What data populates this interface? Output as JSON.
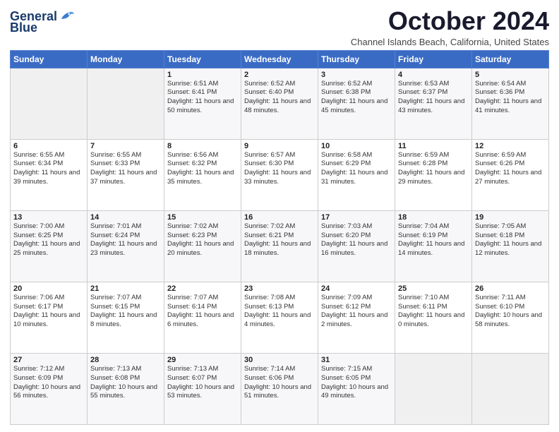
{
  "logo": {
    "line1": "General",
    "line2": "Blue"
  },
  "title": "October 2024",
  "location": "Channel Islands Beach, California, United States",
  "days_of_week": [
    "Sunday",
    "Monday",
    "Tuesday",
    "Wednesday",
    "Thursday",
    "Friday",
    "Saturday"
  ],
  "weeks": [
    [
      {
        "num": "",
        "info": ""
      },
      {
        "num": "",
        "info": ""
      },
      {
        "num": "1",
        "info": "Sunrise: 6:51 AM\nSunset: 6:41 PM\nDaylight: 11 hours and 50 minutes."
      },
      {
        "num": "2",
        "info": "Sunrise: 6:52 AM\nSunset: 6:40 PM\nDaylight: 11 hours and 48 minutes."
      },
      {
        "num": "3",
        "info": "Sunrise: 6:52 AM\nSunset: 6:38 PM\nDaylight: 11 hours and 45 minutes."
      },
      {
        "num": "4",
        "info": "Sunrise: 6:53 AM\nSunset: 6:37 PM\nDaylight: 11 hours and 43 minutes."
      },
      {
        "num": "5",
        "info": "Sunrise: 6:54 AM\nSunset: 6:36 PM\nDaylight: 11 hours and 41 minutes."
      }
    ],
    [
      {
        "num": "6",
        "info": "Sunrise: 6:55 AM\nSunset: 6:34 PM\nDaylight: 11 hours and 39 minutes."
      },
      {
        "num": "7",
        "info": "Sunrise: 6:55 AM\nSunset: 6:33 PM\nDaylight: 11 hours and 37 minutes."
      },
      {
        "num": "8",
        "info": "Sunrise: 6:56 AM\nSunset: 6:32 PM\nDaylight: 11 hours and 35 minutes."
      },
      {
        "num": "9",
        "info": "Sunrise: 6:57 AM\nSunset: 6:30 PM\nDaylight: 11 hours and 33 minutes."
      },
      {
        "num": "10",
        "info": "Sunrise: 6:58 AM\nSunset: 6:29 PM\nDaylight: 11 hours and 31 minutes."
      },
      {
        "num": "11",
        "info": "Sunrise: 6:59 AM\nSunset: 6:28 PM\nDaylight: 11 hours and 29 minutes."
      },
      {
        "num": "12",
        "info": "Sunrise: 6:59 AM\nSunset: 6:26 PM\nDaylight: 11 hours and 27 minutes."
      }
    ],
    [
      {
        "num": "13",
        "info": "Sunrise: 7:00 AM\nSunset: 6:25 PM\nDaylight: 11 hours and 25 minutes."
      },
      {
        "num": "14",
        "info": "Sunrise: 7:01 AM\nSunset: 6:24 PM\nDaylight: 11 hours and 23 minutes."
      },
      {
        "num": "15",
        "info": "Sunrise: 7:02 AM\nSunset: 6:23 PM\nDaylight: 11 hours and 20 minutes."
      },
      {
        "num": "16",
        "info": "Sunrise: 7:02 AM\nSunset: 6:21 PM\nDaylight: 11 hours and 18 minutes."
      },
      {
        "num": "17",
        "info": "Sunrise: 7:03 AM\nSunset: 6:20 PM\nDaylight: 11 hours and 16 minutes."
      },
      {
        "num": "18",
        "info": "Sunrise: 7:04 AM\nSunset: 6:19 PM\nDaylight: 11 hours and 14 minutes."
      },
      {
        "num": "19",
        "info": "Sunrise: 7:05 AM\nSunset: 6:18 PM\nDaylight: 11 hours and 12 minutes."
      }
    ],
    [
      {
        "num": "20",
        "info": "Sunrise: 7:06 AM\nSunset: 6:17 PM\nDaylight: 11 hours and 10 minutes."
      },
      {
        "num": "21",
        "info": "Sunrise: 7:07 AM\nSunset: 6:15 PM\nDaylight: 11 hours and 8 minutes."
      },
      {
        "num": "22",
        "info": "Sunrise: 7:07 AM\nSunset: 6:14 PM\nDaylight: 11 hours and 6 minutes."
      },
      {
        "num": "23",
        "info": "Sunrise: 7:08 AM\nSunset: 6:13 PM\nDaylight: 11 hours and 4 minutes."
      },
      {
        "num": "24",
        "info": "Sunrise: 7:09 AM\nSunset: 6:12 PM\nDaylight: 11 hours and 2 minutes."
      },
      {
        "num": "25",
        "info": "Sunrise: 7:10 AM\nSunset: 6:11 PM\nDaylight: 11 hours and 0 minutes."
      },
      {
        "num": "26",
        "info": "Sunrise: 7:11 AM\nSunset: 6:10 PM\nDaylight: 10 hours and 58 minutes."
      }
    ],
    [
      {
        "num": "27",
        "info": "Sunrise: 7:12 AM\nSunset: 6:09 PM\nDaylight: 10 hours and 56 minutes."
      },
      {
        "num": "28",
        "info": "Sunrise: 7:13 AM\nSunset: 6:08 PM\nDaylight: 10 hours and 55 minutes."
      },
      {
        "num": "29",
        "info": "Sunrise: 7:13 AM\nSunset: 6:07 PM\nDaylight: 10 hours and 53 minutes."
      },
      {
        "num": "30",
        "info": "Sunrise: 7:14 AM\nSunset: 6:06 PM\nDaylight: 10 hours and 51 minutes."
      },
      {
        "num": "31",
        "info": "Sunrise: 7:15 AM\nSunset: 6:05 PM\nDaylight: 10 hours and 49 minutes."
      },
      {
        "num": "",
        "info": ""
      },
      {
        "num": "",
        "info": ""
      }
    ]
  ]
}
